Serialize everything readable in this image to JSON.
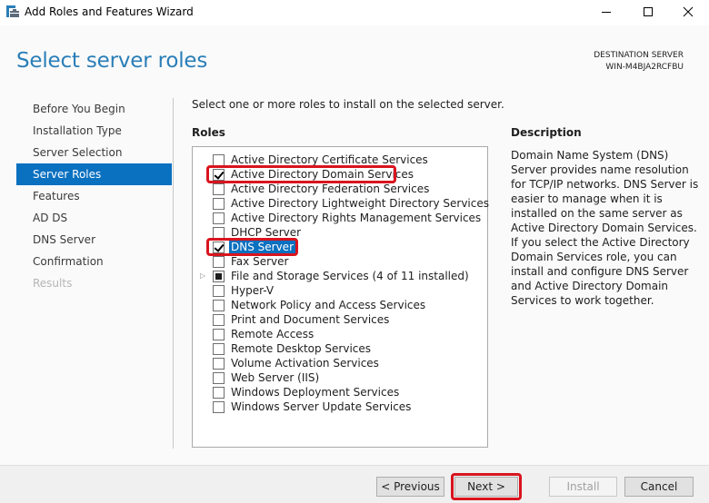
{
  "window": {
    "title": "Add Roles and Features Wizard",
    "controls": {
      "minimize": "minimize-icon",
      "maximize": "maximize-icon",
      "close": "close-icon"
    }
  },
  "header": {
    "page_title": "Select server roles",
    "destination_label": "DESTINATION SERVER",
    "destination_server": "WIN-M4BJA2RCFBU"
  },
  "nav": {
    "items": [
      {
        "label": "Before You Begin",
        "state": "normal"
      },
      {
        "label": "Installation Type",
        "state": "normal"
      },
      {
        "label": "Server Selection",
        "state": "normal"
      },
      {
        "label": "Server Roles",
        "state": "active"
      },
      {
        "label": "Features",
        "state": "normal"
      },
      {
        "label": "AD DS",
        "state": "normal"
      },
      {
        "label": "DNS Server",
        "state": "normal"
      },
      {
        "label": "Confirmation",
        "state": "normal"
      },
      {
        "label": "Results",
        "state": "disabled"
      }
    ]
  },
  "main": {
    "instruction": "Select one or more roles to install on the selected server.",
    "roles_label": "Roles",
    "roles": [
      {
        "label": "Active Directory Certificate Services",
        "checked": false
      },
      {
        "label": "Active Directory Domain Services",
        "checked": true,
        "highlighted": true
      },
      {
        "label": "Active Directory Federation Services",
        "checked": false
      },
      {
        "label": "Active Directory Lightweight Directory Services",
        "checked": false
      },
      {
        "label": "Active Directory Rights Management Services",
        "checked": false
      },
      {
        "label": "DHCP Server",
        "checked": false
      },
      {
        "label": "DNS Server",
        "checked": true,
        "highlighted": true,
        "selected": true
      },
      {
        "label": "Fax Server",
        "checked": false
      },
      {
        "label": "File and Storage Services (4 of 11 installed)",
        "checked": "partial",
        "expandable": true
      },
      {
        "label": "Hyper-V",
        "checked": false
      },
      {
        "label": "Network Policy and Access Services",
        "checked": false
      },
      {
        "label": "Print and Document Services",
        "checked": false
      },
      {
        "label": "Remote Access",
        "checked": false
      },
      {
        "label": "Remote Desktop Services",
        "checked": false
      },
      {
        "label": "Volume Activation Services",
        "checked": false
      },
      {
        "label": "Web Server (IIS)",
        "checked": false
      },
      {
        "label": "Windows Deployment Services",
        "checked": false
      },
      {
        "label": "Windows Server Update Services",
        "checked": false
      }
    ]
  },
  "description": {
    "title": "Description",
    "text": "Domain Name System (DNS) Server provides name resolution for TCP/IP networks. DNS Server is easier to manage when it is installed on the same server as Active Directory Domain Services. If you select the Active Directory Domain Services role, you can install and configure DNS Server and Active Directory Domain Services to work together."
  },
  "footer": {
    "previous_label": "< Previous",
    "next_label": "Next >",
    "install_label": "Install",
    "cancel_label": "Cancel"
  },
  "colors": {
    "accent": "#0a70c0",
    "title_blue": "#2a7eb8",
    "highlight_red": "#d9141e"
  }
}
